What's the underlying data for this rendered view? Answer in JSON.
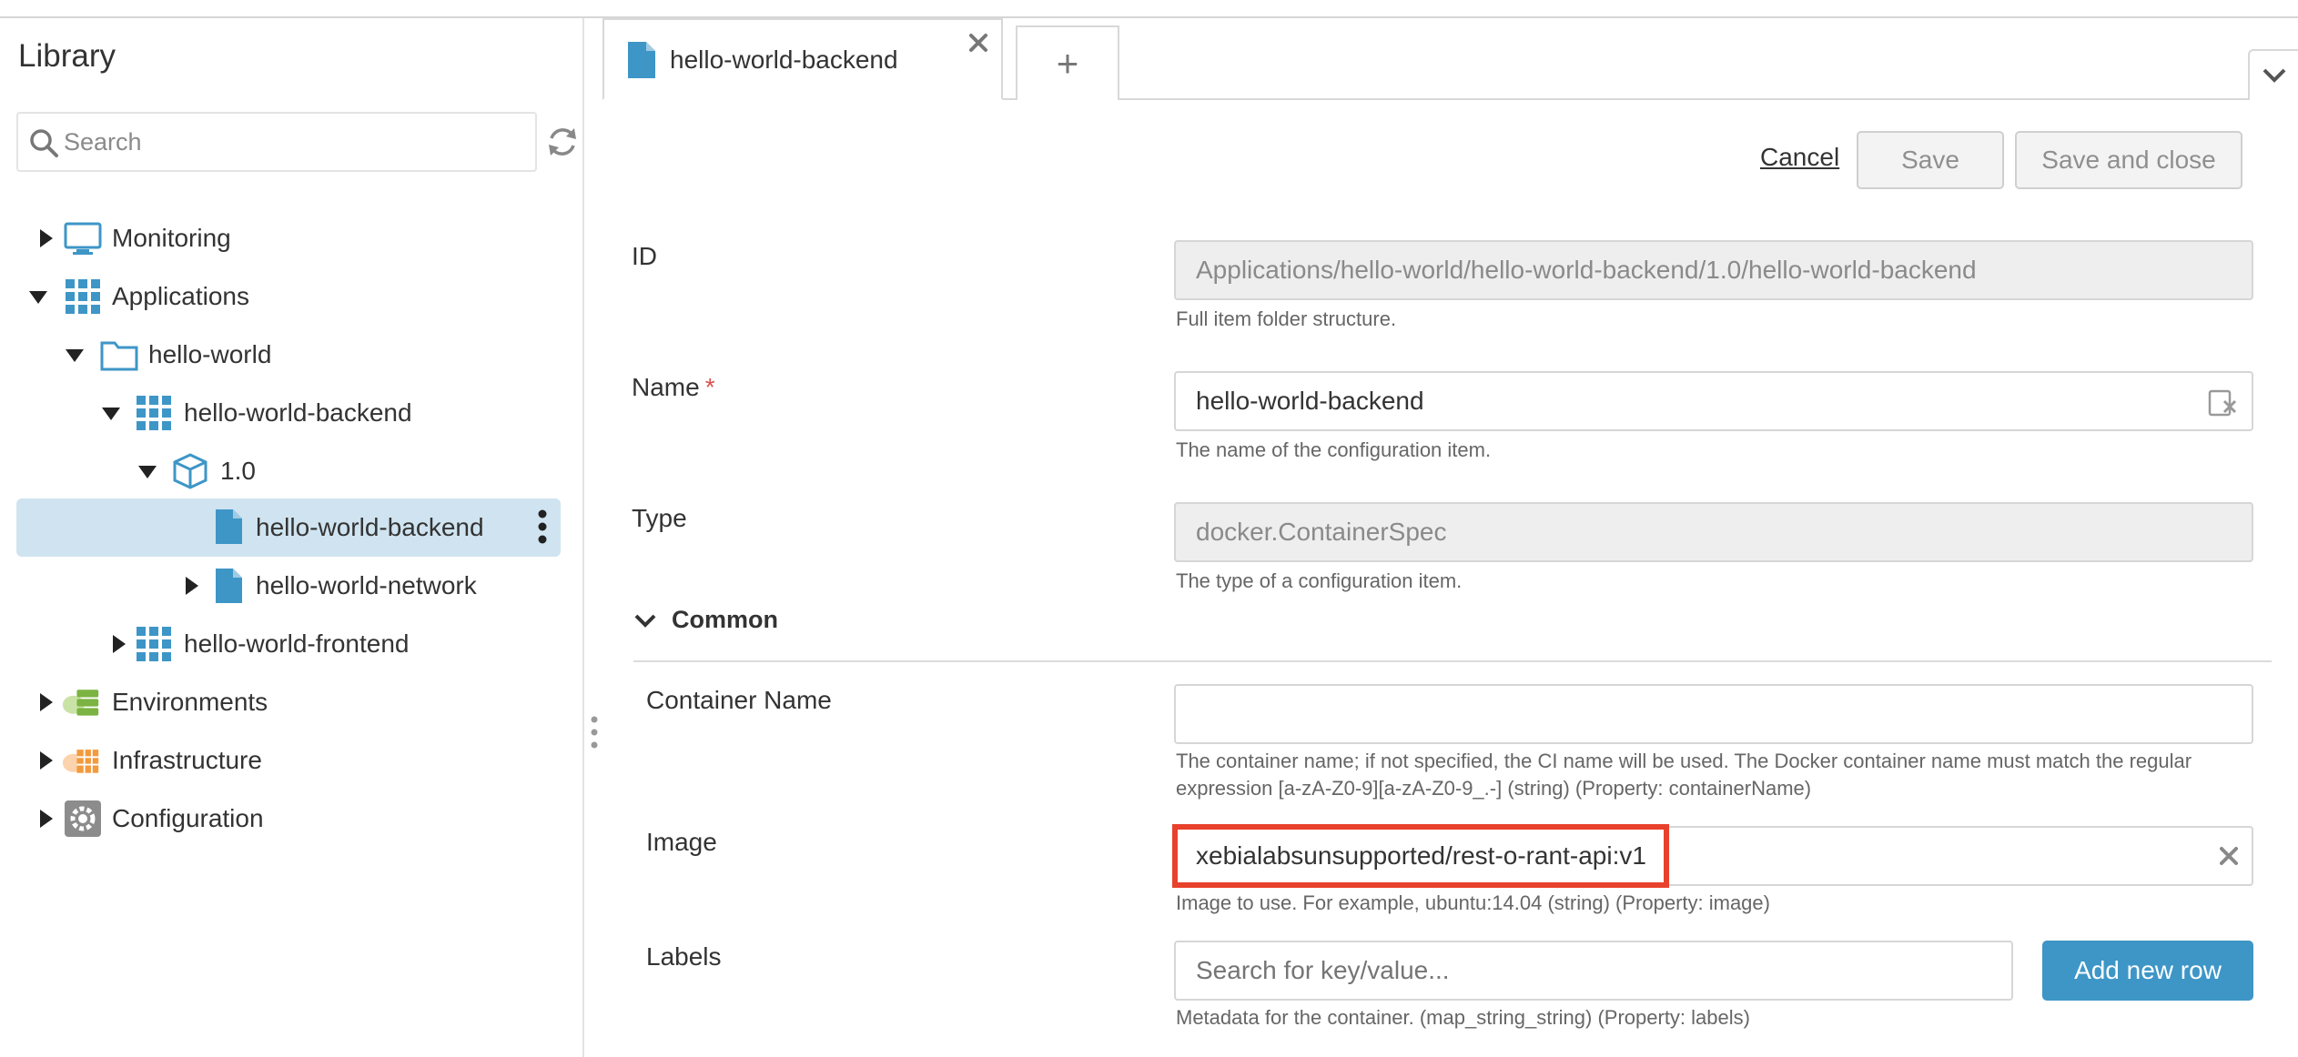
{
  "sidebar": {
    "title": "Library",
    "search_placeholder": "Search",
    "tree": {
      "monitoring": "Monitoring",
      "applications": "Applications",
      "hello_world": "hello-world",
      "hello_world_backend": "hello-world-backend",
      "version": "1.0",
      "backend_spec": "hello-world-backend",
      "network_spec": "hello-world-network",
      "hello_world_frontend": "hello-world-frontend",
      "environments": "Environments",
      "infrastructure": "Infrastructure",
      "configuration": "Configuration"
    }
  },
  "tabs": {
    "active_label": "hello-world-backend",
    "add_label": "+"
  },
  "actions": {
    "cancel": "Cancel",
    "save": "Save",
    "save_and_close": "Save and close"
  },
  "form": {
    "id": {
      "label": "ID",
      "value": "Applications/hello-world/hello-world-backend/1.0/hello-world-backend",
      "help": "Full item folder structure."
    },
    "name": {
      "label": "Name",
      "required_mark": "*",
      "value": "hello-world-backend",
      "help": "The name of the configuration item."
    },
    "type": {
      "label": "Type",
      "value": "docker.ContainerSpec",
      "help": "The type of a configuration item."
    },
    "section": "Common",
    "container_name": {
      "label": "Container Name",
      "value": "",
      "help_line1": "The container name; if not specified, the CI name will be used. The Docker container name must match the regular",
      "help_line2": "expression [a-zA-Z0-9][a-zA-Z0-9_.-] (string) (Property: containerName)"
    },
    "image": {
      "label": "Image",
      "value": "xebialabsunsupported/rest-o-rant-api:v1",
      "help": "Image to use. For example, ubuntu:14.04 (string) (Property: image)"
    },
    "labels": {
      "label": "Labels",
      "placeholder": "Search for key/value...",
      "add_button": "Add new row",
      "help": "Metadata for the container. (map_string_string) (Property: labels)"
    }
  },
  "colors": {
    "accent": "#3e96c7",
    "selected_row": "#cfe4f0",
    "highlight": "#e8412c"
  }
}
